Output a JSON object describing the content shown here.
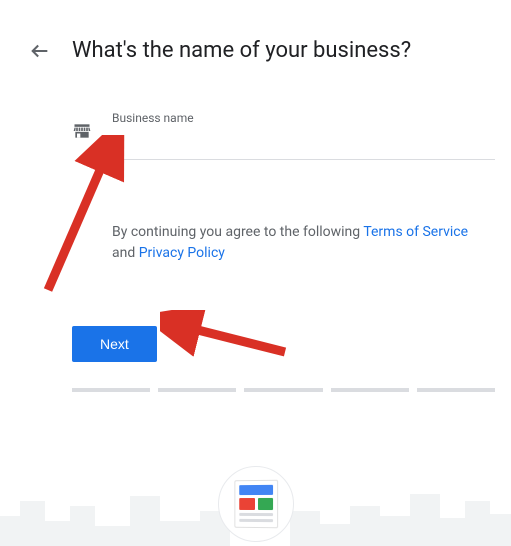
{
  "header": {
    "title": "What's the name of your business?"
  },
  "form": {
    "input_label": "Business name",
    "input_value": ""
  },
  "agreement": {
    "prefix": "By continuing you agree to the following ",
    "tos": "Terms of Service",
    "and": " and ",
    "privacy": "Privacy Policy"
  },
  "actions": {
    "next": "Next"
  }
}
